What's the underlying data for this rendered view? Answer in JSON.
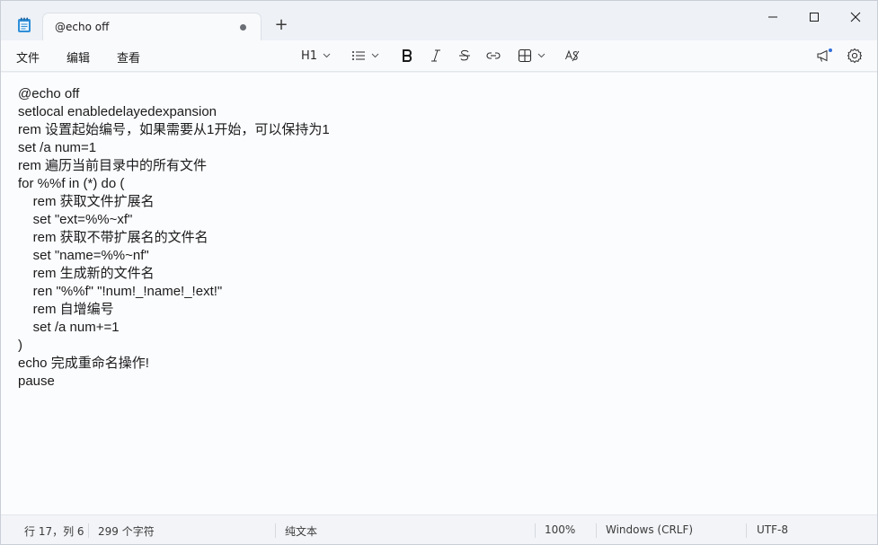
{
  "tab": {
    "title": "@echo off",
    "new_tab": "+"
  },
  "menu": [
    {
      "label": "文件"
    },
    {
      "label": "编辑"
    },
    {
      "label": "查看"
    }
  ],
  "toolbar": {
    "heading": "H1",
    "icons": [
      "list-icon",
      "bold-icon",
      "italic-icon",
      "strikethrough-icon",
      "link-icon",
      "table-icon",
      "clear-format-icon"
    ]
  },
  "editor": {
    "lines": [
      "@echo off",
      "setlocal enabledelayedexpansion",
      "rem 设置起始编号，如果需要从1开始，可以保持为1",
      "set /a num=1",
      "rem 遍历当前目录中的所有文件",
      "for %%f in (*) do (",
      "    rem 获取文件扩展名",
      "    set \"ext=%%~xf\"",
      "    rem 获取不带扩展名的文件名",
      "    set \"name=%%~nf\"",
      "    rem 生成新的文件名",
      "    ren \"%%f\" \"!num!_!name!_!ext!\"",
      "    rem 自增编号",
      "    set /a num+=1",
      ")",
      "echo 完成重命名操作!",
      "pause"
    ]
  },
  "status": {
    "position": "行 17，列 6",
    "chars": "299 个字符",
    "format": "纯文本",
    "zoom": "100%",
    "line_ending": "Windows (CRLF)",
    "encoding": "UTF-8"
  }
}
